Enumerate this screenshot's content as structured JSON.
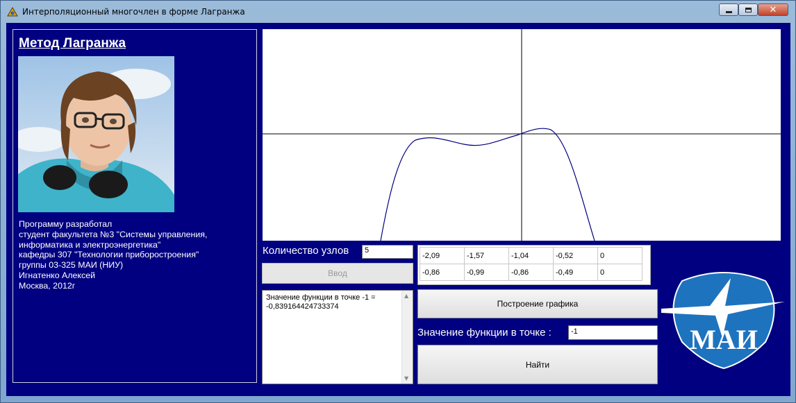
{
  "window": {
    "title": "Интерполяционный многочлен в форме Лагранжа",
    "icon": "delphi-app-icon",
    "controls": {
      "minimize": "minimize-icon",
      "maximize": "maximize-icon",
      "close": "close-icon"
    }
  },
  "info": {
    "title": "Метод Лагранжа",
    "photo": "author-photo",
    "credits": [
      "Программу разработал",
      "студент факультета №3 \"Системы управления,",
      "информатика и электроэнергетика\"",
      "кафедры 307 \"Технологии приборостроения\"",
      "группы 03-325 МАИ (НИУ)",
      "Игнатенко Алексей",
      "Москва, 2012г"
    ]
  },
  "graph": {
    "background": "#ffffff",
    "axis_color": "#000000",
    "curve_color": "#000080"
  },
  "nodes": {
    "label": "Количество узлов",
    "value": "5"
  },
  "enter_button": {
    "label": "Ввод",
    "enabled": false
  },
  "result": {
    "text": "Значение функции в точке -1 = -0,839164424733374"
  },
  "table": {
    "rows": [
      [
        "-2,09",
        "-1,57",
        "-1,04",
        "-0,52",
        "0"
      ],
      [
        "-0,86",
        "-0,99",
        "-0,86",
        "-0,49",
        "0"
      ]
    ]
  },
  "plot_button": {
    "label": "Построение графика"
  },
  "point": {
    "label": "Значение функции в точке :",
    "value": "-1"
  },
  "find_button": {
    "label": "Найти"
  },
  "logo": {
    "text": "МАИ",
    "color": "#1e73be"
  }
}
